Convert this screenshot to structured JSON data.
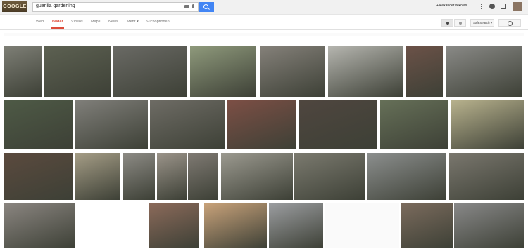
{
  "logo_text": "GOOGLE",
  "search": {
    "query": "guerilla gardening"
  },
  "user": {
    "name": "+Alexander Nikolas"
  },
  "nav": {
    "web": "Web",
    "images": "Bilder",
    "videos": "Videos",
    "maps": "Maps",
    "news": "News",
    "more": "Mehr ▾",
    "tools": "Suchoptionen"
  },
  "safesearch": "SafeSearch ▾",
  "results": [
    {
      "bg": "#7e7f76"
    },
    {
      "bg": "#5d6152"
    },
    {
      "bg": "#6a6a65"
    },
    {
      "bg": "#8f9a7c"
    },
    {
      "bg": "#85817a"
    },
    {
      "bg": "#b6b6b0"
    },
    {
      "bg": "#6c5248"
    },
    {
      "bg": "#8a8a87"
    },
    {
      "bg": "#4e5a46"
    },
    {
      "bg": "#807f7a"
    },
    {
      "bg": "#6e6c65"
    },
    {
      "bg": "#7d4f45"
    },
    {
      "bg": "#4f463f"
    },
    {
      "bg": "#667058"
    },
    {
      "bg": "#b9b38e"
    },
    {
      "bg": "#5b4a3e"
    },
    {
      "bg": "#a59d86"
    },
    {
      "bg": "#8d8b85"
    },
    {
      "bg": "#9b948a"
    },
    {
      "bg": "#7f7a73"
    },
    {
      "bg": "#9c9a90"
    },
    {
      "bg": "#7b7a6f"
    },
    {
      "bg": "#8c8f8e"
    },
    {
      "bg": "#7a776e"
    },
    {
      "bg": "#8a8580"
    },
    {
      "bg": "#ffffff"
    },
    {
      "bg": "#8b6a5a"
    },
    {
      "bg": "#c8a27a"
    },
    {
      "bg": "#9b9da0"
    },
    {
      "bg": "#fafafa"
    },
    {
      "bg": "#7b6b5d"
    }
  ]
}
